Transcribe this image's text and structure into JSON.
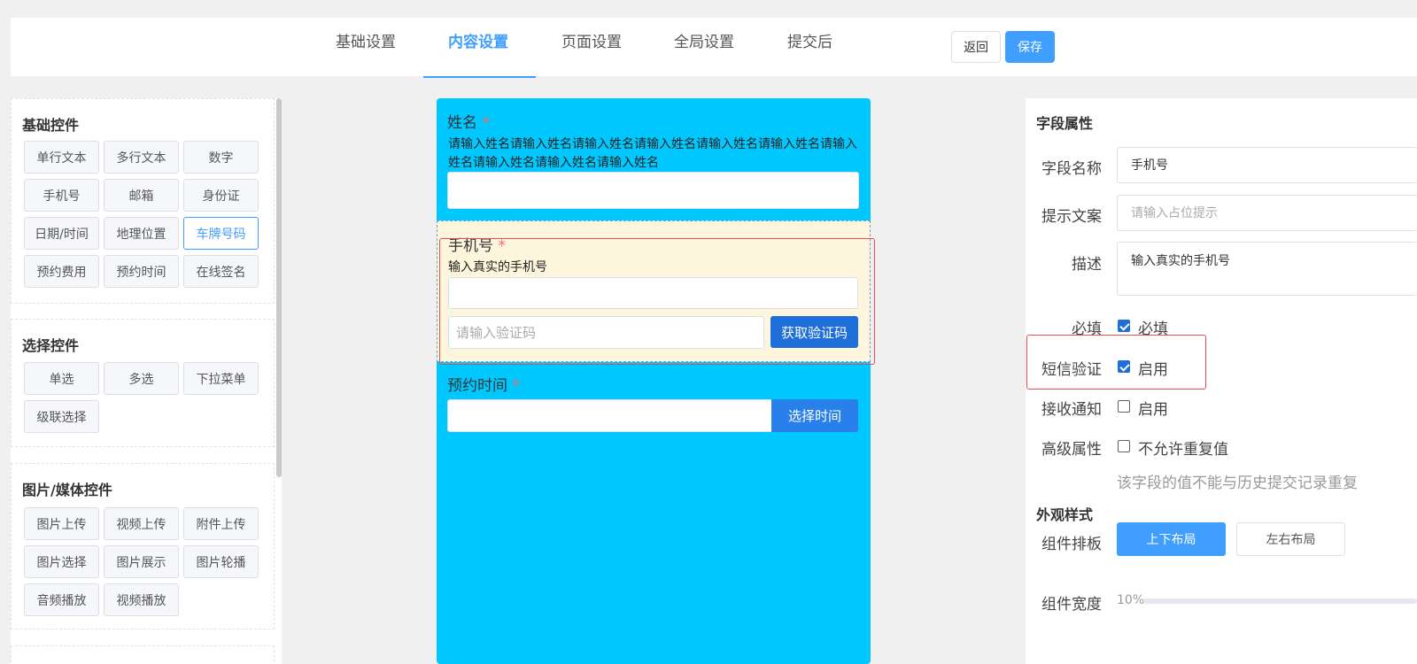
{
  "tabs": [
    "基础设置",
    "内容设置",
    "页面设置",
    "全局设置",
    "提交后"
  ],
  "active_tab": "内容设置",
  "header": {
    "back_label": "返回",
    "save_label": "保存"
  },
  "left": {
    "basic": {
      "title": "基础控件",
      "items": [
        "单行文本",
        "多行文本",
        "数字",
        "手机号",
        "邮箱",
        "身份证",
        "日期/时间",
        "地理位置",
        "车牌号码",
        "预约费用",
        "预约时间",
        "在线签名"
      ]
    },
    "choice": {
      "title": "选择控件",
      "items": [
        "单选",
        "多选",
        "下拉菜单",
        "级联选择"
      ]
    },
    "media": {
      "title": "图片/媒体控件",
      "items": [
        "图片上传",
        "视频上传",
        "附件上传",
        "图片选择",
        "图片展示",
        "图片轮播",
        "音频播放",
        "视频播放"
      ]
    },
    "selected_item": "车牌号码"
  },
  "form": {
    "name": {
      "label": "姓名",
      "required_mark": "*",
      "desc": "请输入姓名请输入姓名请输入姓名请输入姓名请输入姓名请输入姓名请输入姓名请输入姓名请输入姓名请输入姓名",
      "value": ""
    },
    "phone": {
      "label": "手机号",
      "required_mark": "*",
      "desc": "输入真实的手机号",
      "value": "",
      "code_placeholder": "请输入验证码",
      "code_button": "获取验证码"
    },
    "time": {
      "label": "预约时间",
      "required_mark": "*",
      "value": "",
      "button": "选择时间"
    }
  },
  "props": {
    "title": "字段属性",
    "field_name_label": "字段名称",
    "field_name_value": "手机号",
    "hint_label": "提示文案",
    "hint_placeholder": "请输入占位提示",
    "desc_label": "描述",
    "desc_value": "输入真实的手机号",
    "required_label": "必填",
    "required_text": "必填",
    "sms_label": "短信验证",
    "sms_text": "启用",
    "notify_label": "接收通知",
    "notify_text": "启用",
    "advanced_label": "高级属性",
    "advanced_text": "不允许重复值",
    "advanced_hint": "该字段的值不能与历史提交记录重复",
    "appearance_title": "外观样式",
    "layout_label": "组件排板",
    "layout_options": [
      "上下布局",
      "左右布局"
    ],
    "layout_selected": "上下布局",
    "width_label": "组件宽度",
    "width_value": "10%",
    "checks": {
      "required": true,
      "sms": true,
      "notify": false,
      "advanced": false
    }
  },
  "colors": {
    "primary": "#409eff",
    "form_bg": "#00c8ff",
    "selected_field_bg": "#fdf6dc",
    "highlight_red": "#e84c4c"
  }
}
